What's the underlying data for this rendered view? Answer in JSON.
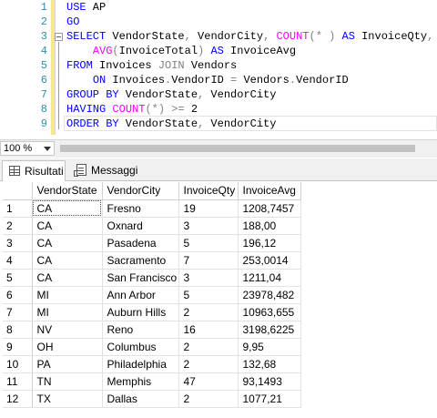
{
  "editor": {
    "line_numbers": [
      "1",
      "2",
      "3",
      "4",
      "5",
      "6",
      "7",
      "8",
      "9"
    ],
    "lines": [
      [
        {
          "t": "kw",
          "v": "USE"
        },
        {
          "t": "tx",
          "v": " AP"
        }
      ],
      [
        {
          "t": "kw",
          "v": "GO"
        }
      ],
      [
        {
          "t": "kw",
          "v": "SELECT"
        },
        {
          "t": "tx",
          "v": " VendorState"
        },
        {
          "t": "op",
          "v": ","
        },
        {
          "t": "tx",
          "v": " VendorCity"
        },
        {
          "t": "op",
          "v": ","
        },
        {
          "t": "tx",
          "v": " "
        },
        {
          "t": "fn",
          "v": "COUNT"
        },
        {
          "t": "op",
          "v": "("
        },
        {
          "t": "op",
          "v": "*"
        },
        {
          "t": "tx",
          "v": " "
        },
        {
          "t": "op",
          "v": ")"
        },
        {
          "t": "tx",
          "v": " "
        },
        {
          "t": "kw",
          "v": "AS"
        },
        {
          "t": "tx",
          "v": " InvoiceQty"
        },
        {
          "t": "op",
          "v": ","
        }
      ],
      [
        {
          "t": "tx",
          "v": "    "
        },
        {
          "t": "fn",
          "v": "AVG"
        },
        {
          "t": "op",
          "v": "("
        },
        {
          "t": "tx",
          "v": "InvoiceTotal"
        },
        {
          "t": "op",
          "v": ")"
        },
        {
          "t": "tx",
          "v": " "
        },
        {
          "t": "kw",
          "v": "AS"
        },
        {
          "t": "tx",
          "v": " InvoiceAvg"
        }
      ],
      [
        {
          "t": "kw",
          "v": "FROM"
        },
        {
          "t": "tx",
          "v": " Invoices "
        },
        {
          "t": "op",
          "v": "JOIN"
        },
        {
          "t": "tx",
          "v": " Vendors"
        }
      ],
      [
        {
          "t": "tx",
          "v": "    "
        },
        {
          "t": "kw",
          "v": "ON"
        },
        {
          "t": "tx",
          "v": " Invoices"
        },
        {
          "t": "op",
          "v": "."
        },
        {
          "t": "tx",
          "v": "VendorID "
        },
        {
          "t": "op",
          "v": "="
        },
        {
          "t": "tx",
          "v": " Vendors"
        },
        {
          "t": "op",
          "v": "."
        },
        {
          "t": "tx",
          "v": "VendorID"
        }
      ],
      [
        {
          "t": "kw",
          "v": "GROUP BY"
        },
        {
          "t": "tx",
          "v": " VendorState"
        },
        {
          "t": "op",
          "v": ","
        },
        {
          "t": "tx",
          "v": " VendorCity"
        }
      ],
      [
        {
          "t": "kw",
          "v": "HAVING"
        },
        {
          "t": "tx",
          "v": " "
        },
        {
          "t": "fn",
          "v": "COUNT"
        },
        {
          "t": "op",
          "v": "("
        },
        {
          "t": "op",
          "v": "*"
        },
        {
          "t": "op",
          "v": ")"
        },
        {
          "t": "tx",
          "v": " "
        },
        {
          "t": "op",
          "v": ">="
        },
        {
          "t": "tx",
          "v": " 2"
        }
      ],
      [
        {
          "t": "kw",
          "v": "ORDER BY"
        },
        {
          "t": "tx",
          "v": " VendorState"
        },
        {
          "t": "op",
          "v": ","
        },
        {
          "t": "tx",
          "v": " VendorCity"
        }
      ]
    ]
  },
  "zoom": {
    "value": "100 %"
  },
  "tabs": {
    "results_label": "Risultati",
    "messages_label": "Messaggi"
  },
  "results": {
    "headers": [
      "VendorState",
      "VendorCity",
      "InvoiceQty",
      "InvoiceAvg"
    ],
    "rows": [
      [
        "1",
        "CA",
        "Fresno",
        "19",
        "1208,7457"
      ],
      [
        "2",
        "CA",
        "Oxnard",
        "3",
        "188,00"
      ],
      [
        "3",
        "CA",
        "Pasadena",
        "5",
        "196,12"
      ],
      [
        "4",
        "CA",
        "Sacramento",
        "7",
        "253,0014"
      ],
      [
        "5",
        "CA",
        "San Francisco",
        "3",
        "1211,04"
      ],
      [
        "6",
        "MI",
        "Ann Arbor",
        "5",
        "23978,482"
      ],
      [
        "7",
        "MI",
        "Auburn Hills",
        "2",
        "10963,655"
      ],
      [
        "8",
        "NV",
        "Reno",
        "16",
        "3198,6225"
      ],
      [
        "9",
        "OH",
        "Columbus",
        "2",
        "9,95"
      ],
      [
        "10",
        "PA",
        "Philadelphia",
        "2",
        "132,68"
      ],
      [
        "11",
        "TN",
        "Memphis",
        "47",
        "93,1493"
      ],
      [
        "12",
        "TX",
        "Dallas",
        "2",
        "1077,21"
      ]
    ]
  },
  "colors": {
    "keyword": "#0000ff",
    "function": "#ff00ff",
    "operator": "#808080",
    "line_number": "#2b91af"
  }
}
